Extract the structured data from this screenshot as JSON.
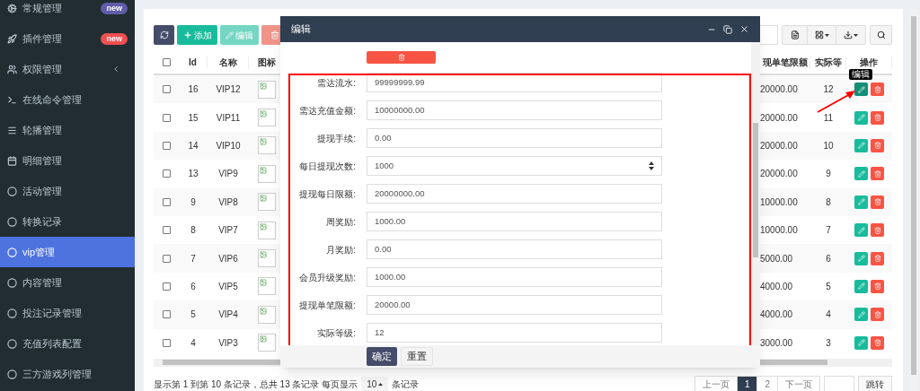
{
  "sidebar": {
    "items": [
      {
        "label": "常规管理",
        "selected": false,
        "badge": {
          "text": "new",
          "color": "#605ca8"
        }
      },
      {
        "label": "插件管理",
        "selected": false,
        "badge": {
          "text": "new",
          "color": "#f05050"
        }
      },
      {
        "label": "权限管理",
        "selected": false,
        "expandable": true
      },
      {
        "label": "在线命令管理",
        "selected": false
      },
      {
        "label": "轮播管理",
        "selected": false
      },
      {
        "label": "明细管理",
        "selected": false
      },
      {
        "label": "活动管理",
        "selected": false
      },
      {
        "label": "转换记录",
        "selected": false
      },
      {
        "label": "vip管理",
        "selected": true
      },
      {
        "label": "内容管理",
        "selected": false
      },
      {
        "label": "投注记录管理",
        "selected": false
      },
      {
        "label": "充值列表配置",
        "selected": false
      },
      {
        "label": "三方游戏列管理",
        "selected": false
      }
    ]
  },
  "toolbar": {
    "buttons": [
      {
        "kind": "refresh",
        "disabled": false
      },
      {
        "kind": "add",
        "label": "添加",
        "disabled": false
      },
      {
        "kind": "edit",
        "label": "编辑",
        "disabled": true
      },
      {
        "kind": "delete",
        "disabled": true
      }
    ]
  },
  "table": {
    "columns": [
      "Id",
      "名称",
      "图标",
      "现单笔限额",
      "实际等",
      "操作"
    ],
    "tooltip": "编辑",
    "all_checked": false,
    "rows": [
      {
        "id": "16",
        "name": "VIP12",
        "limit": "20000.00",
        "level": "12",
        "hovered": true,
        "checked": false
      },
      {
        "id": "15",
        "name": "VIP11",
        "limit": "20000.00",
        "level": "11",
        "hovered": false,
        "checked": false
      },
      {
        "id": "14",
        "name": "VIP10",
        "limit": "20000.00",
        "level": "10",
        "hovered": false,
        "checked": false
      },
      {
        "id": "13",
        "name": "VIP9",
        "limit": "20000.00",
        "level": "9",
        "hovered": false,
        "checked": false
      },
      {
        "id": "9",
        "name": "VIP8",
        "limit": "10000.00",
        "level": "8",
        "hovered": false,
        "checked": false
      },
      {
        "id": "8",
        "name": "VIP7",
        "limit": "10000.00",
        "level": "7",
        "hovered": false,
        "checked": false
      },
      {
        "id": "7",
        "name": "VIP6",
        "limit": "5000.00",
        "level": "6",
        "hovered": false,
        "checked": false
      },
      {
        "id": "6",
        "name": "VIP5",
        "limit": "4000.00",
        "level": "5",
        "hovered": false,
        "checked": false
      },
      {
        "id": "5",
        "name": "VIP4",
        "limit": "4000.00",
        "level": "4",
        "hovered": false,
        "checked": false
      },
      {
        "id": "4",
        "name": "VIP3",
        "limit": "3000.00",
        "level": "3",
        "hovered": false,
        "checked": false
      }
    ]
  },
  "footer": {
    "summary": "显示第 1 到第 10 条记录，总共 13 条记录 每页显示",
    "page_size": "10",
    "page_size_suffix": "条记录",
    "pages": [
      {
        "label": "上一页",
        "selected": false
      },
      {
        "label": "1",
        "selected": true
      },
      {
        "label": "2",
        "selected": false
      },
      {
        "label": "下一页",
        "selected": false
      }
    ],
    "go_button": "跳转"
  },
  "modal": {
    "title": "编辑",
    "fields": [
      {
        "label": "需达流水:",
        "value": "99999999.99",
        "kind": "text"
      },
      {
        "label": "需达充值金额:",
        "value": "10000000.00",
        "kind": "text"
      },
      {
        "label": "提现手续:",
        "value": "0.00",
        "kind": "text"
      },
      {
        "label": "每日提现次数:",
        "value": "1000",
        "kind": "number"
      },
      {
        "label": "提现每日限额:",
        "value": "20000000.00",
        "kind": "text"
      },
      {
        "label": "周奖励:",
        "value": "1000.00",
        "kind": "text"
      },
      {
        "label": "月奖励:",
        "value": "0.00",
        "kind": "text"
      },
      {
        "label": "会员升级奖励:",
        "value": "1000.00",
        "kind": "text"
      },
      {
        "label": "提现单笔限额:",
        "value": "20000.00",
        "kind": "text"
      },
      {
        "label": "实际等级:",
        "value": "12",
        "kind": "text"
      }
    ],
    "buttons": [
      {
        "label": "确定",
        "kind": "primary"
      },
      {
        "label": "重置",
        "kind": "default"
      }
    ]
  }
}
